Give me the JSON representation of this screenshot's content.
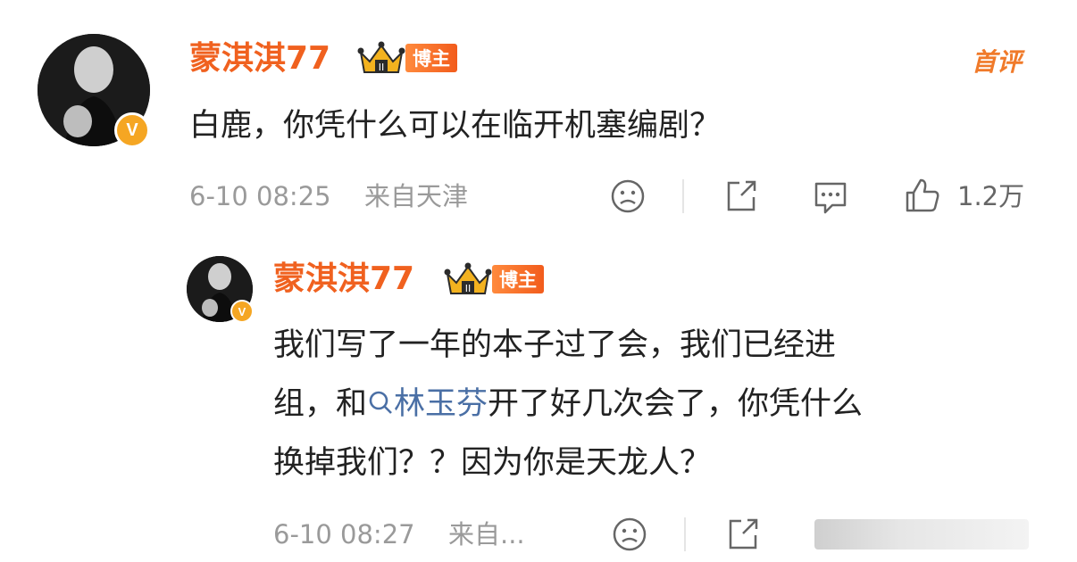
{
  "comment": {
    "username": "蒙淇淇77",
    "badge_label": "博主",
    "first_comment_badge": "首评",
    "text": "白鹿，你凭什么可以在临开机塞编剧？",
    "timestamp": "6-10 08:25",
    "location": "来自天津",
    "like_count": "1.2万"
  },
  "reply": {
    "username": "蒙淇淇77",
    "badge_label": "博主",
    "line1": "我们写了一年的本子过了会，我们已经进",
    "line2_prefix": "组，和",
    "mention": "林玉芬",
    "line2_suffix": "开了好几次会了，你凭什么",
    "line3": "换掉我们？？因为你是天龙人？",
    "timestamp": "6-10 08:27",
    "location": "来自..."
  },
  "colors": {
    "username": "#f0611f",
    "badge": "#f25c1c",
    "verified": "#f5a623",
    "link": "#4a6fa5",
    "meta": "#9a9a9a"
  },
  "icons": [
    "sad-face-icon",
    "share-icon",
    "comment-icon",
    "like-icon",
    "verified-icon",
    "crown-icon",
    "search-icon"
  ]
}
